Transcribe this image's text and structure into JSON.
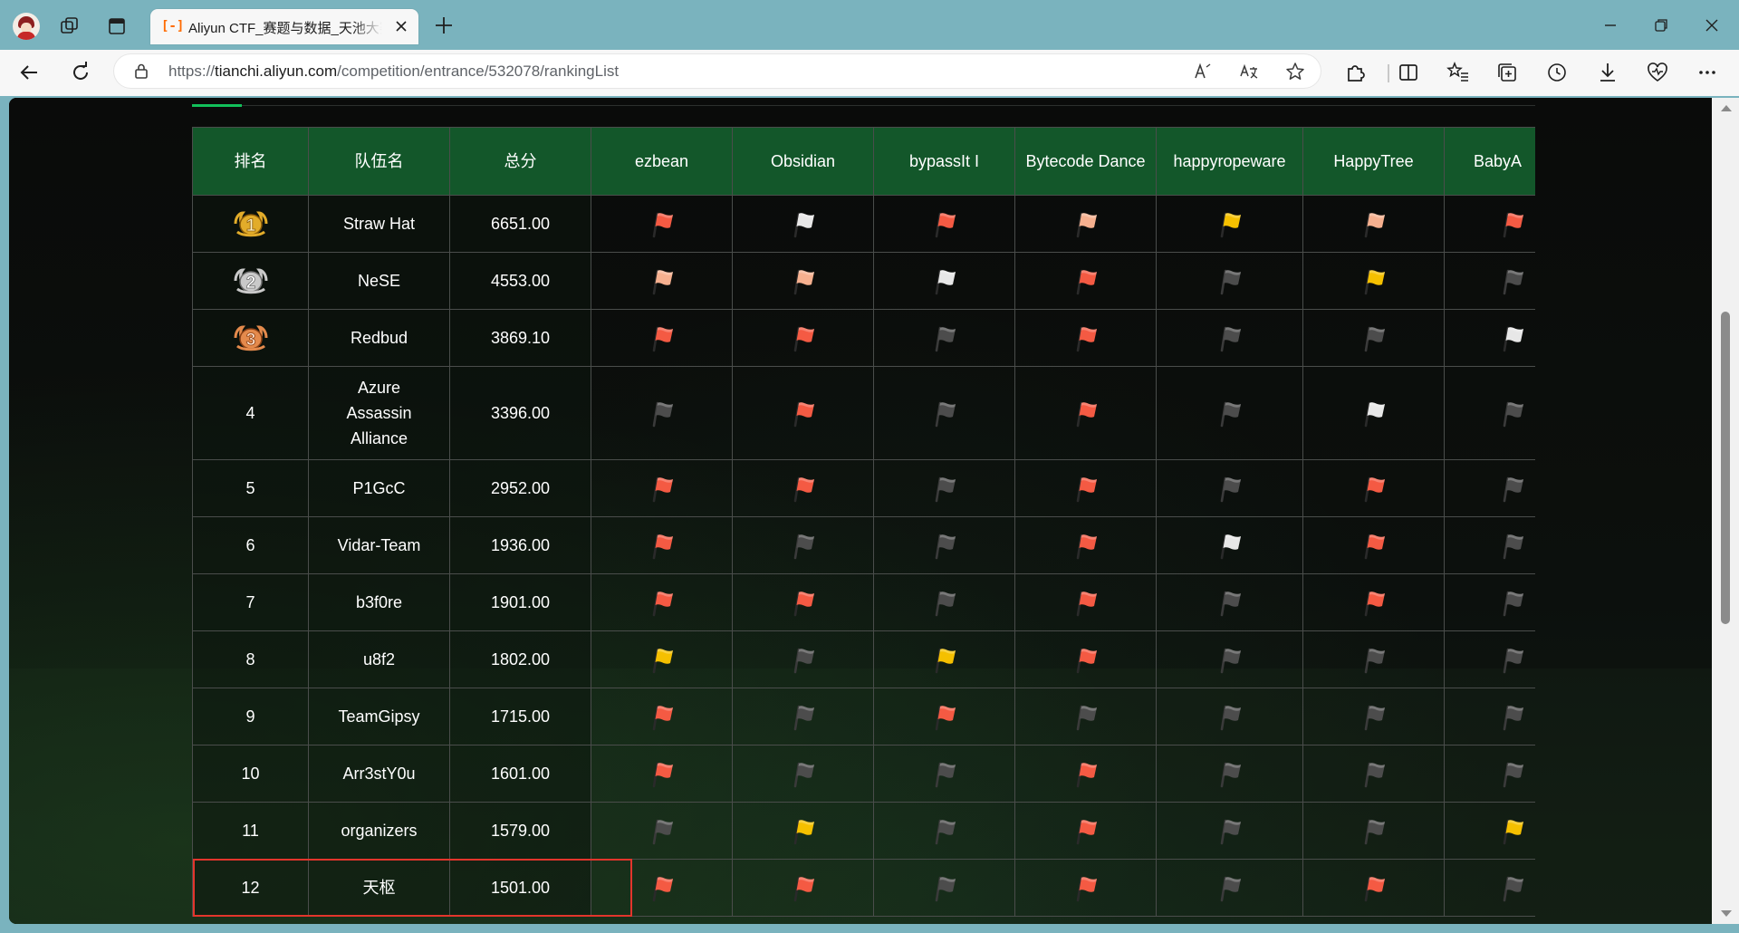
{
  "browser": {
    "tab_title": "Aliyun CTF_赛题与数据_天池大赛",
    "url_prefix": "https://",
    "url_host": "tianchi.aliyun.com",
    "url_path": "/competition/entrance/532078/rankingList"
  },
  "table": {
    "headers": [
      "排名",
      "队伍名",
      "总分",
      "ezbean",
      "Obsidian",
      "bypassIt I",
      "Bytecode Dance",
      "happyropeware",
      "HappyTree",
      "BabyA"
    ],
    "rows": [
      {
        "rank": "1",
        "medal": "gold",
        "team": "Straw Hat",
        "score": "6651.00",
        "flags": [
          "red",
          "white",
          "red",
          "peach",
          "gold",
          "peach",
          "red"
        ]
      },
      {
        "rank": "2",
        "medal": "silver",
        "team": "NeSE",
        "score": "4553.00",
        "flags": [
          "peach",
          "peach",
          "white",
          "red",
          "gray",
          "gold",
          "gray"
        ]
      },
      {
        "rank": "3",
        "medal": "bronze",
        "team": "Redbud",
        "score": "3869.10",
        "flags": [
          "red",
          "red",
          "gray",
          "red",
          "gray",
          "gray",
          "white"
        ]
      },
      {
        "rank": "4",
        "medal": "",
        "team": "Azure Assassin Alliance",
        "score": "3396.00",
        "flags": [
          "gray",
          "red",
          "gray",
          "red",
          "gray",
          "white",
          "gray"
        ]
      },
      {
        "rank": "5",
        "medal": "",
        "team": "P1GcC",
        "score": "2952.00",
        "flags": [
          "red",
          "red",
          "gray",
          "red",
          "gray",
          "red",
          "gray"
        ]
      },
      {
        "rank": "6",
        "medal": "",
        "team": "Vidar-Team",
        "score": "1936.00",
        "flags": [
          "red",
          "gray",
          "gray",
          "red",
          "white",
          "red",
          "gray"
        ]
      },
      {
        "rank": "7",
        "medal": "",
        "team": "b3f0re",
        "score": "1901.00",
        "flags": [
          "red",
          "red",
          "gray",
          "red",
          "gray",
          "red",
          "gray"
        ]
      },
      {
        "rank": "8",
        "medal": "",
        "team": "u8f2",
        "score": "1802.00",
        "flags": [
          "gold",
          "gray",
          "gold",
          "red",
          "gray",
          "gray",
          "gray"
        ]
      },
      {
        "rank": "9",
        "medal": "",
        "team": "TeamGipsy",
        "score": "1715.00",
        "flags": [
          "red",
          "gray",
          "red",
          "gray",
          "gray",
          "gray",
          "gray"
        ]
      },
      {
        "rank": "10",
        "medal": "",
        "team": "Arr3stY0u",
        "score": "1601.00",
        "flags": [
          "red",
          "gray",
          "gray",
          "red",
          "gray",
          "gray",
          "gray"
        ]
      },
      {
        "rank": "11",
        "medal": "",
        "team": "organizers",
        "score": "1579.00",
        "flags": [
          "gray",
          "gold",
          "gray",
          "red",
          "gray",
          "gray",
          "gold"
        ]
      },
      {
        "rank": "12",
        "medal": "",
        "team": "天枢",
        "score": "1501.00",
        "flags": [
          "red",
          "red",
          "gray",
          "red",
          "gray",
          "red",
          "gray"
        ]
      }
    ]
  },
  "colors": {
    "header_bg": "#13572a",
    "accent_green": "#12c05a",
    "highlight_border": "#e3352c",
    "flag_red": "#f45a43",
    "flag_peach": "#f6b08f",
    "flag_white": "#e7e7e7",
    "flag_gold": "#f5c000",
    "flag_gray": "#4c4c4c"
  }
}
